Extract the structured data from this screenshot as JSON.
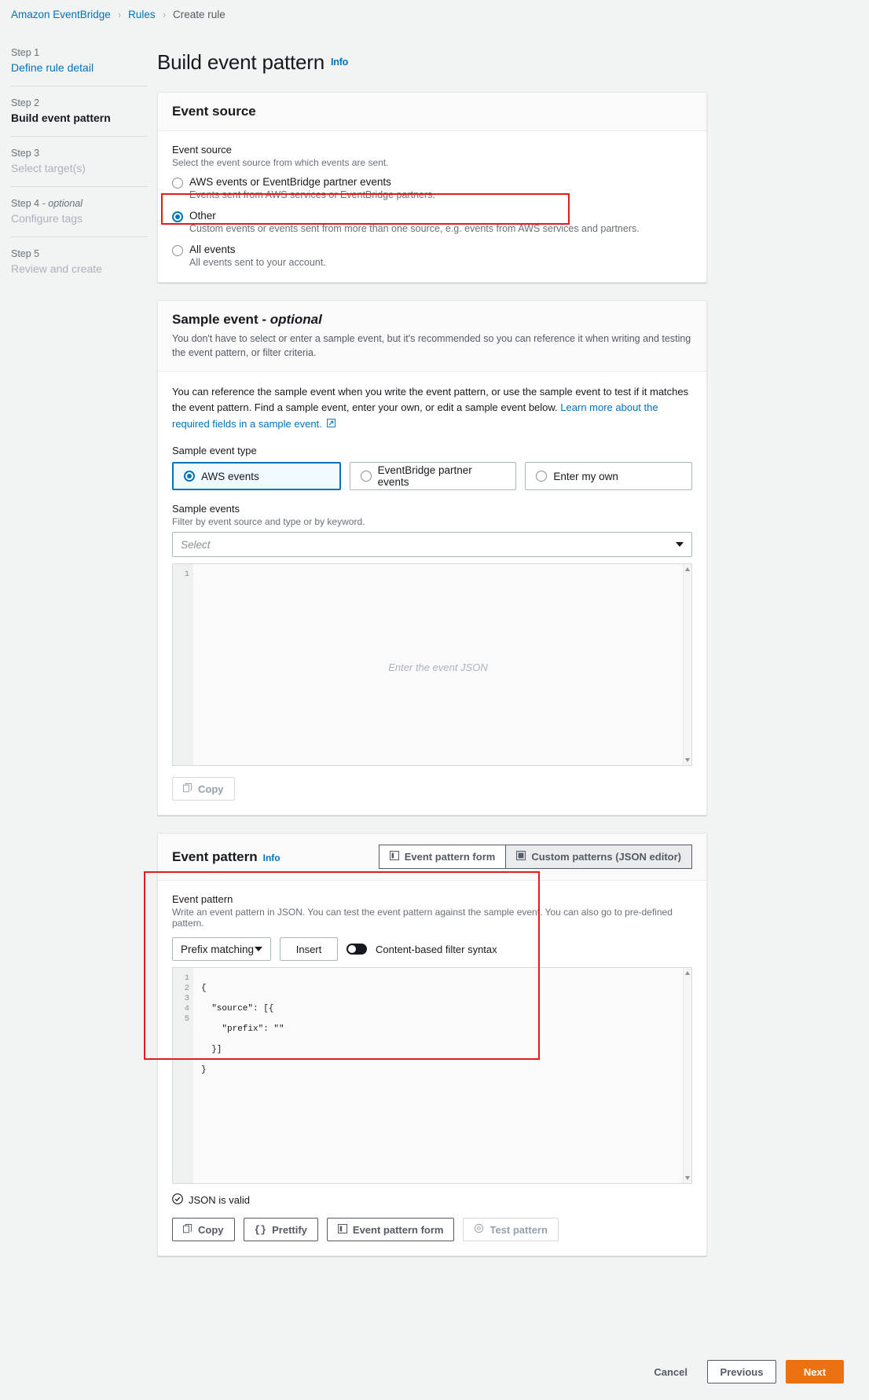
{
  "breadcrumb": {
    "items": [
      {
        "label": "Amazon EventBridge",
        "current": false
      },
      {
        "label": "Rules",
        "current": false
      },
      {
        "label": "Create rule",
        "current": true
      }
    ],
    "separator": "›"
  },
  "sidebar": {
    "steps": [
      {
        "num": "Step 1",
        "title": "Define rule detail",
        "state": "link"
      },
      {
        "num": "Step 2",
        "title": "Build event pattern",
        "state": "active"
      },
      {
        "num": "Step 3",
        "title": "Select target(s)",
        "state": "disabled"
      },
      {
        "num": "Step 4",
        "num_optional": " - optional",
        "title": "Configure tags",
        "state": "disabled"
      },
      {
        "num": "Step 5",
        "title": "Review and create",
        "state": "disabled"
      }
    ]
  },
  "page": {
    "title": "Build event pattern",
    "info_label": "Info"
  },
  "event_source": {
    "card_title": "Event source",
    "field_label": "Event source",
    "field_hint": "Select the event source from which events are sent.",
    "options": [
      {
        "label": "AWS events or EventBridge partner events",
        "description": "Events sent from AWS services or EventBridge partners.",
        "selected": false
      },
      {
        "label": "Other",
        "description": "Custom events or events sent from more than one source, e.g. events from AWS services and partners.",
        "selected": true,
        "highlighted": true
      },
      {
        "label": "All events",
        "description": "All events sent to your account.",
        "selected": false
      }
    ]
  },
  "sample_event": {
    "card_title": "Sample event - ",
    "card_title_optional": "optional",
    "card_desc": "You don't have to select or enter a sample event, but it's recommended so you can reference it when writing and testing the event pattern, or filter criteria.",
    "body_text_1": "You can reference the sample event when you write the event pattern, or use the sample event to test if it matches the event pattern. Find a sample event, enter your own, or edit a sample event below. ",
    "body_link": "Learn more about the required fields in a sample event.",
    "type_label": "Sample event type",
    "types": [
      {
        "label": "AWS events",
        "selected": true
      },
      {
        "label": "EventBridge partner events",
        "selected": false
      },
      {
        "label": "Enter my own",
        "selected": false
      }
    ],
    "events_label": "Sample events",
    "events_hint": "Filter by event source and type or by keyword.",
    "select_placeholder": "Select",
    "editor_gutter": [
      "1"
    ],
    "editor_placeholder": "Enter the event JSON",
    "copy_label": "Copy"
  },
  "event_pattern": {
    "card_title": "Event pattern",
    "info_label": "Info",
    "tabs": [
      {
        "label": "Event pattern form",
        "icon": "pattern-form-icon",
        "active": false
      },
      {
        "label": "Custom patterns (JSON editor)",
        "icon": "json-editor-icon",
        "active": true
      }
    ],
    "field_label": "Event pattern",
    "field_hint": "Write an event pattern in JSON. You can test the event pattern against the sample event. You can also go to pre-defined pattern.",
    "matcher_select": "Prefix matching",
    "insert_label": "Insert",
    "toggle_label": "Content-based filter syntax",
    "toggle_on": true,
    "editor_lines": [
      {
        "n": "1",
        "text": "{"
      },
      {
        "n": "2",
        "text": "  \"source\": [{"
      },
      {
        "n": "3",
        "text": "    \"prefix\": \"\""
      },
      {
        "n": "4",
        "text": "  }]"
      },
      {
        "n": "5",
        "text": "}"
      }
    ],
    "validity_text": "JSON is valid",
    "actions": [
      {
        "label": "Copy",
        "icon": "copy-icon",
        "disabled": false
      },
      {
        "label": "Prettify",
        "icon": "braces-icon",
        "disabled": false
      },
      {
        "label": "Event pattern form",
        "icon": "pattern-form-icon",
        "disabled": false
      },
      {
        "label": "Test pattern",
        "icon": "gear-icon",
        "disabled": true
      }
    ]
  },
  "footer": {
    "cancel": "Cancel",
    "previous": "Previous",
    "next": "Next"
  },
  "colors": {
    "accent": "#0073bb",
    "primary": "#ec7211",
    "highlight": "#e31b1b",
    "valid": "#1d8102"
  }
}
